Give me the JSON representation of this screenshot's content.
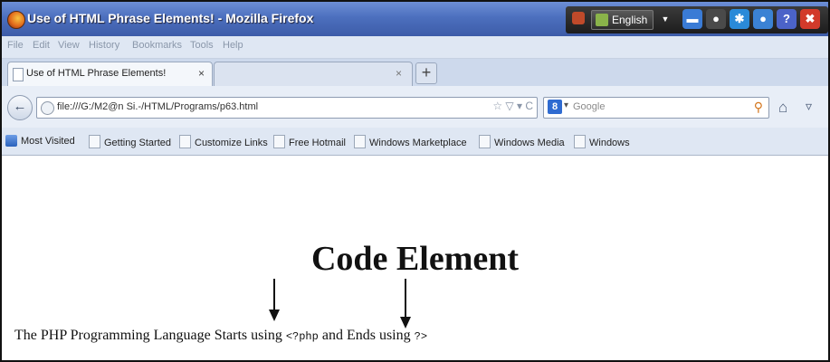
{
  "window": {
    "title": "Use of HTML Phrase Elements! - Mozilla Firefox",
    "language_label": "English"
  },
  "menu": [
    "File",
    "Edit",
    "View",
    "History",
    "Bookmarks",
    "Tools",
    "Help"
  ],
  "tabs": [
    {
      "label": "Use of HTML Phrase Elements!",
      "close": "×"
    },
    {
      "label": "",
      "close": "×"
    }
  ],
  "new_tab_symbol": "+",
  "nav": {
    "back_symbol": "←",
    "url": "file:///G:/M2@n Si.-/HTML/Programs/p63.html",
    "url_buttons": "☆ ▽ ▾ C",
    "search_engine_letter": "8",
    "search_placeholder": "Google",
    "search_dropdown": "▾",
    "search_symbol": "⚲",
    "home_symbol": "⌂",
    "pocket_symbol": "▿"
  },
  "bookmarks": [
    "Most Visited",
    "Getting Started",
    "Customize Links",
    "Free Hotmail",
    "Windows Marketplace",
    "Windows Media",
    "Windows"
  ],
  "page": {
    "heading": "Code Element",
    "text_before": "The PHP Programming Language Starts using ",
    "code_start": "<?php",
    "text_middle": " and Ends using ",
    "code_end": "?>"
  },
  "toolbar_icons": [
    {
      "name": "minimize",
      "symbol": "▬",
      "color": "#3a7bd5"
    },
    {
      "name": "mouse",
      "symbol": "●",
      "color": "#4a4a4a"
    },
    {
      "name": "settings",
      "symbol": "✱",
      "color": "#2a8ad8"
    },
    {
      "name": "shield",
      "symbol": "●",
      "color": "#3b82d4"
    },
    {
      "name": "help",
      "symbol": "?",
      "color": "#4b63c8"
    },
    {
      "name": "close",
      "symbol": "✖",
      "color": "#d23a2a"
    }
  ]
}
